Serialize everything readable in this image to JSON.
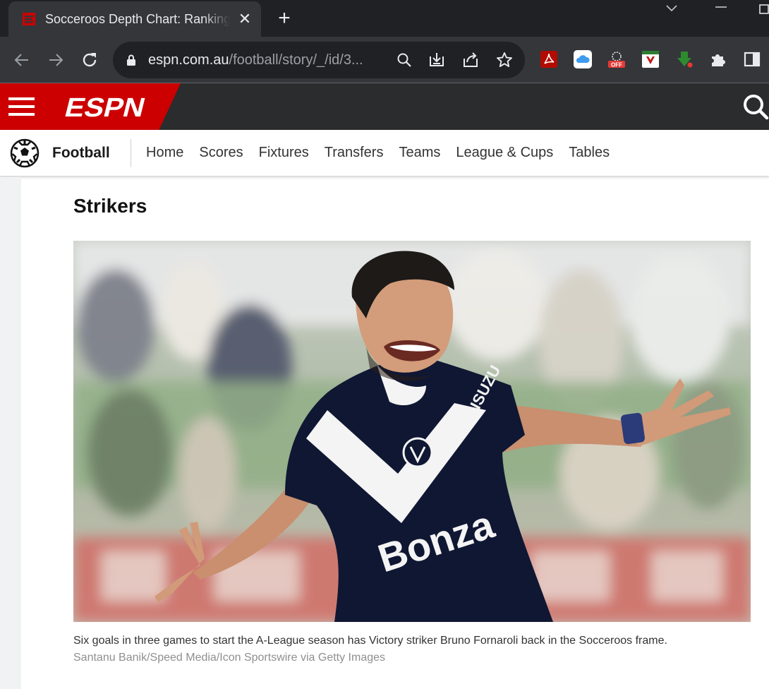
{
  "browser": {
    "tab_title": "Socceroos Depth Chart: Rankings",
    "url_host": "espn.com.au",
    "url_path": "/football/story/_/id/3..."
  },
  "espn": {
    "logo_text": "ESPN"
  },
  "subnav": {
    "sport": "Football",
    "items": [
      "Home",
      "Scores",
      "Fixtures",
      "Transfers",
      "Teams",
      "League & Cups",
      "Tables"
    ]
  },
  "article": {
    "section_heading": "Strikers",
    "hero_alt": "Melbourne Victory striker celebrating with arms outstretched",
    "caption": "Six goals in three games to start the A-League season has Victory striker Bruno Fornaroli back in the Socceroos frame.",
    "credit": "Santanu Banik/Speed Media/Icon Sportswire via Getty Images",
    "shirt_text": "Bonza",
    "sleeve_text": "ISUZU"
  },
  "colors": {
    "espn_red": "#cc0000",
    "chrome_dark": "#202124",
    "chrome_toolbar": "#35363a",
    "victory_navy": "#0f1733"
  }
}
